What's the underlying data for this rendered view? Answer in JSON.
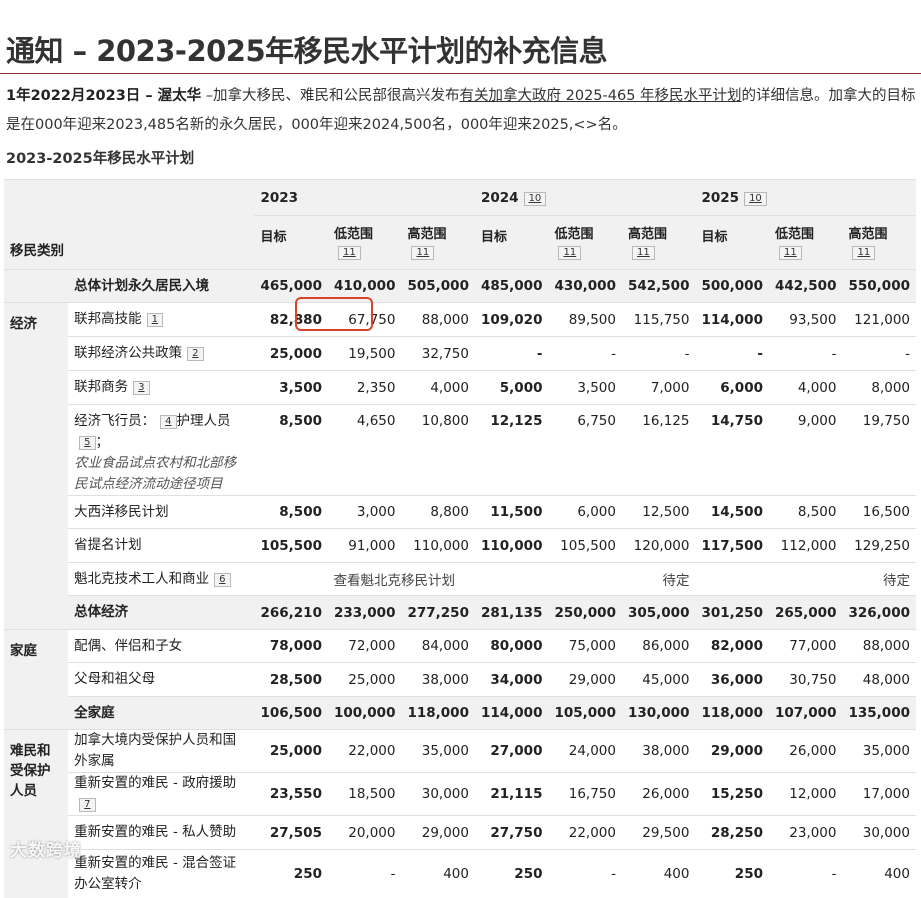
{
  "page": {
    "title": "通知 – 2023-2025年移民水平计划的补充信息",
    "intro_date": "1年2022月2023日 – 渥太华",
    "intro_before_link": " –加拿大移民、难民和公民部很高兴发布",
    "intro_link": "有关加拿大政府 2025-465 年移民水平计划",
    "intro_after_link": "的详细信息。加拿大的目标是在000年迎来2023,485名新的永久居民，000年迎来2024,500名，000年迎来2025,<>名。",
    "subtitle": "2023-2025年移民水平计划"
  },
  "table": {
    "category_header": "移民类别",
    "years": [
      {
        "label": "2023",
        "footnote": ""
      },
      {
        "label": "2024",
        "footnote": "10"
      },
      {
        "label": "2025",
        "footnote": "10"
      }
    ],
    "target_label": "目标",
    "low_label": "低范围",
    "high_label": "高范围",
    "low_fn": "11",
    "high_fn": "11",
    "rows": [
      {
        "program": "总体计划永久居民入境",
        "subtotal": true,
        "values": [
          "465,000",
          "410,000",
          "505,000",
          "485,000",
          "430,000",
          "542,500",
          "500,000",
          "442,500",
          "550,000"
        ]
      },
      {
        "category": "经济",
        "program": "联邦高技能",
        "footnote": "1",
        "values": [
          "82,880",
          "67,750",
          "88,000",
          "109,020",
          "89,500",
          "115,750",
          "114,000",
          "93,500",
          "121,000"
        ]
      },
      {
        "program": "联邦经济公共政策",
        "footnote": "2",
        "values": [
          "25,000",
          "19,500",
          "32,750",
          "-",
          "-",
          "-",
          "-",
          "-",
          "-"
        ]
      },
      {
        "program": "联邦商务",
        "footnote": "3",
        "values": [
          "3,500",
          "2,350",
          "4,000",
          "5,000",
          "3,500",
          "7,000",
          "6,000",
          "4,000",
          "8,000"
        ]
      },
      {
        "program": "经济飞行员：",
        "footnote": "4",
        "program_b": "护理人员",
        "footnote_b": "5",
        "program_c": "；",
        "program_italic": "农业食品试点农村和北部移民试点经济流动途径项目",
        "values": [
          "8,500",
          "4,650",
          "10,800",
          "12,125",
          "6,750",
          "16,125",
          "14,750",
          "9,000",
          "19,750"
        ]
      },
      {
        "program": "大西洋移民计划",
        "values": [
          "8,500",
          "3,000",
          "8,800",
          "11,500",
          "6,000",
          "12,500",
          "14,500",
          "8,500",
          "16,500"
        ]
      },
      {
        "program": "省提名计划",
        "values": [
          "105,500",
          "91,000",
          "110,000",
          "110,000",
          "105,500",
          "120,000",
          "117,500",
          "112,000",
          "129,250"
        ]
      },
      {
        "program": "魁北克技术工人和商业",
        "footnote": "6",
        "note_center": "查看魁北克移民计划",
        "note_2024": "待定",
        "note_2025": "待定"
      },
      {
        "program": "总体经济",
        "subtotal": true,
        "values": [
          "266,210",
          "233,000",
          "277,250",
          "281,135",
          "250,000",
          "305,000",
          "301,250",
          "265,000",
          "326,000"
        ]
      },
      {
        "category": "家庭",
        "program": "配偶、伴侣和子女",
        "values": [
          "78,000",
          "72,000",
          "84,000",
          "80,000",
          "75,000",
          "86,000",
          "82,000",
          "77,000",
          "88,000"
        ]
      },
      {
        "program": "父母和祖父母",
        "values": [
          "28,500",
          "25,000",
          "38,000",
          "34,000",
          "29,000",
          "45,000",
          "36,000",
          "30,750",
          "48,000"
        ]
      },
      {
        "program": "全家庭",
        "subtotal": true,
        "values": [
          "106,500",
          "100,000",
          "118,000",
          "114,000",
          "105,000",
          "130,000",
          "118,000",
          "107,000",
          "135,000"
        ]
      },
      {
        "category": "难民和受保护人员",
        "program": "加拿大境内受保护人员和国外家属",
        "values": [
          "25,000",
          "22,000",
          "35,000",
          "27,000",
          "24,000",
          "38,000",
          "29,000",
          "26,000",
          "35,000"
        ]
      },
      {
        "program": "重新安置的难民 - 政府援助",
        "footnote": "7",
        "values": [
          "23,550",
          "18,500",
          "30,000",
          "21,115",
          "16,750",
          "26,000",
          "15,250",
          "12,000",
          "17,000"
        ]
      },
      {
        "program": "重新安置的难民 - 私人赞助",
        "values": [
          "27,505",
          "20,000",
          "29,000",
          "27,750",
          "22,000",
          "29,500",
          "28,250",
          "23,000",
          "30,000"
        ]
      },
      {
        "program": "重新安置的难民 - 混合签证办公室转介",
        "values": [
          "250",
          "-",
          "400",
          "250",
          "-",
          "400",
          "250",
          "-",
          "400"
        ]
      }
    ]
  },
  "watermark": "大数跨境"
}
